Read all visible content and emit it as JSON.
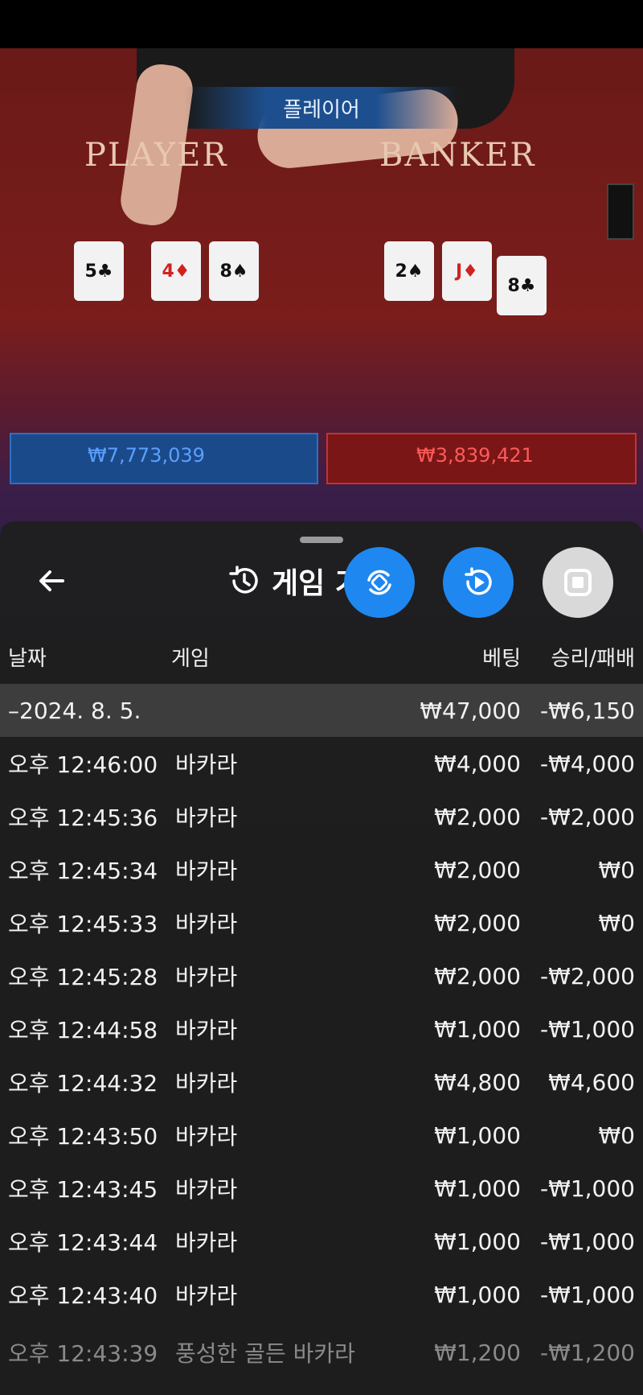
{
  "game_view": {
    "status_banner": "플레이어",
    "player_label": "PLAYER",
    "banker_label": "BANKER",
    "player_cards": [
      {
        "rank": "5",
        "suit": "♣",
        "red": false
      },
      {
        "rank": "4",
        "suit": "♦",
        "red": true
      },
      {
        "rank": "8",
        "suit": "♠",
        "red": false
      }
    ],
    "banker_cards": [
      {
        "rank": "2",
        "suit": "♠",
        "red": false
      },
      {
        "rank": "J",
        "suit": "♦",
        "red": true
      },
      {
        "rank": "8",
        "suit": "♣",
        "red": false
      }
    ],
    "player_total_bet": "₩7,773,039",
    "banker_total_bet": "₩3,839,421"
  },
  "history_sheet": {
    "back_icon": "arrow-left-icon",
    "history_icon": "history-icon",
    "title": "게임 기록",
    "fab_buttons": [
      {
        "icon": "sync-icon",
        "color": "#1e88f0"
      },
      {
        "icon": "replay-play-icon",
        "color": "#1e88f0"
      },
      {
        "icon": "stop-icon",
        "color": "#d9d9d9"
      }
    ],
    "columns": {
      "date": "날짜",
      "game": "게임",
      "bet": "베팅",
      "result": "승리/패배"
    },
    "date_group": {
      "date": "–2024. 8. 5.",
      "bet": "₩47,000",
      "result": "-₩6,150"
    },
    "rows": [
      {
        "time": "오후 12:46:00",
        "game": "바카라",
        "bet": "₩4,000",
        "result": "-₩4,000"
      },
      {
        "time": "오후 12:45:36",
        "game": "바카라",
        "bet": "₩2,000",
        "result": "-₩2,000"
      },
      {
        "time": "오후 12:45:34",
        "game": "바카라",
        "bet": "₩2,000",
        "result": "₩0"
      },
      {
        "time": "오후 12:45:33",
        "game": "바카라",
        "bet": "₩2,000",
        "result": "₩0"
      },
      {
        "time": "오후 12:45:28",
        "game": "바카라",
        "bet": "₩2,000",
        "result": "-₩2,000"
      },
      {
        "time": "오후 12:44:58",
        "game": "바카라",
        "bet": "₩1,000",
        "result": "-₩1,000"
      },
      {
        "time": "오후 12:44:32",
        "game": "바카라",
        "bet": "₩4,800",
        "result": "₩4,600"
      },
      {
        "time": "오후 12:43:50",
        "game": "바카라",
        "bet": "₩1,000",
        "result": "₩0"
      },
      {
        "time": "오후 12:43:45",
        "game": "바카라",
        "bet": "₩1,000",
        "result": "-₩1,000"
      },
      {
        "time": "오후 12:43:44",
        "game": "바카라",
        "bet": "₩1,000",
        "result": "-₩1,000"
      },
      {
        "time": "오후 12:43:40",
        "game": "바카라",
        "bet": "₩1,000",
        "result": "-₩1,000"
      },
      {
        "time": "오후 12:43:39",
        "game": "풍성한 골든 바카라",
        "bet": "₩1,200",
        "result": "-₩1,200"
      }
    ]
  }
}
